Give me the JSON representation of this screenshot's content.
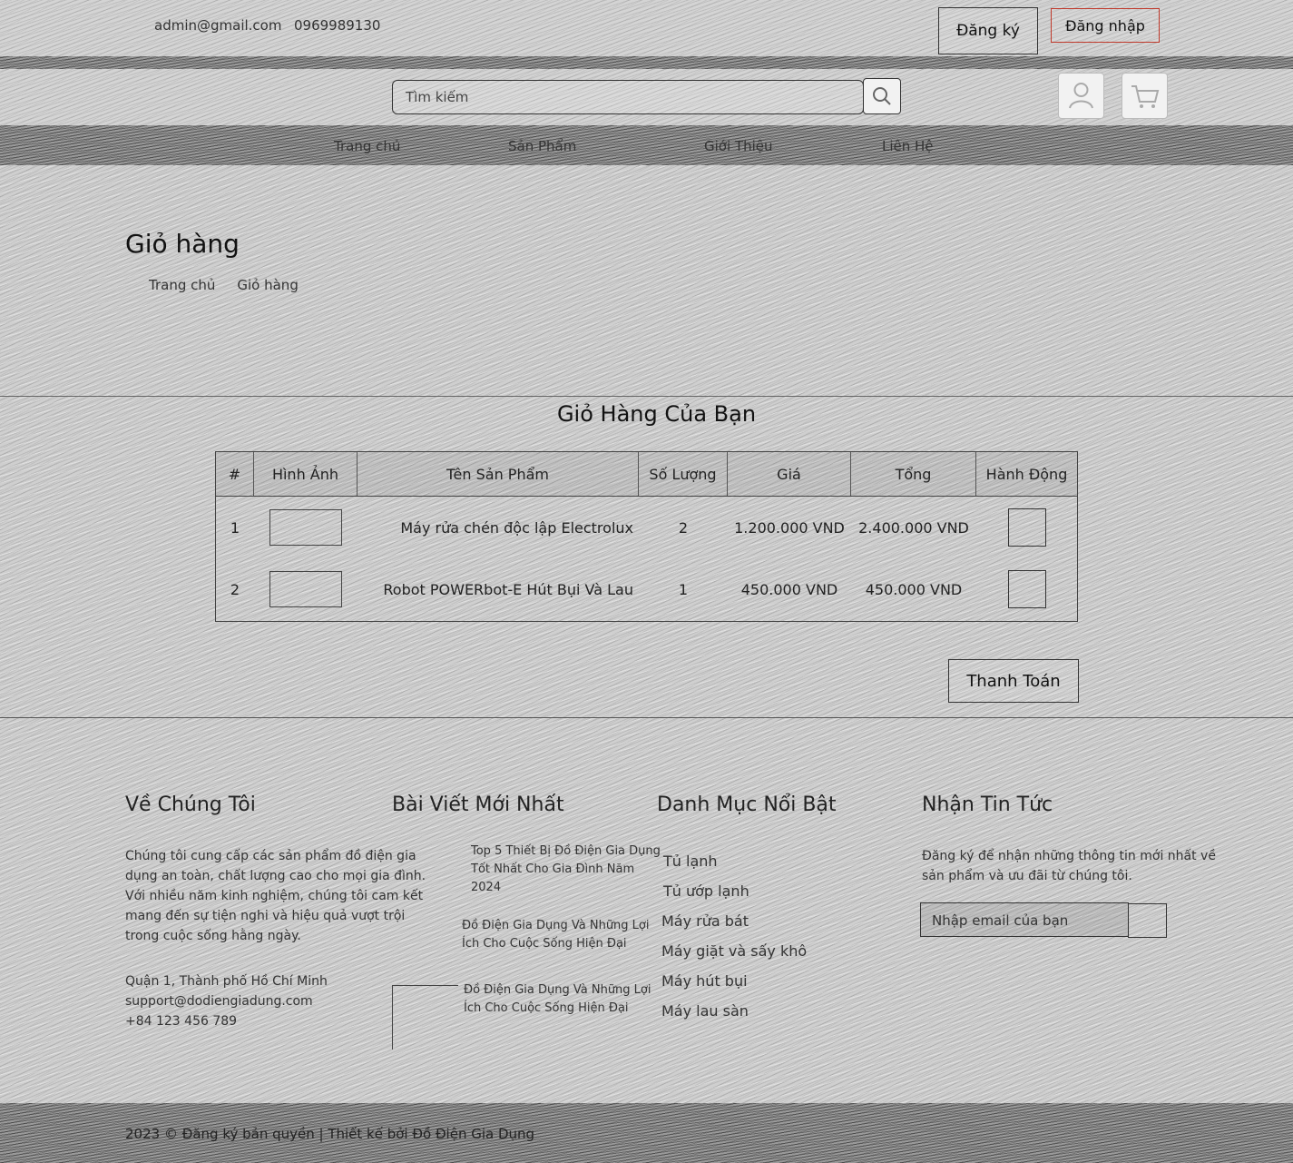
{
  "topbar": {
    "email": "admin@gmail.com",
    "phone": "0969989130",
    "register_label": "Đăng ký",
    "login_label": "Đăng nhập"
  },
  "search": {
    "placeholder": "Tìm kiếm"
  },
  "nav": {
    "items": [
      {
        "label": "Trang chủ"
      },
      {
        "label": "Sản Phẩm"
      },
      {
        "label": "Giới Thiệu"
      },
      {
        "label": "Liên Hệ"
      }
    ]
  },
  "page": {
    "title": "Giỏ hàng",
    "breadcrumb": [
      "Trang chủ",
      "Giỏ hàng"
    ]
  },
  "cart": {
    "heading": "Giỏ Hàng Của Bạn",
    "columns": [
      "#",
      "Hình Ảnh",
      "Tên Sản Phẩm",
      "Số Lượng",
      "Giá",
      "Tổng",
      "Hành Động"
    ],
    "rows": [
      {
        "index": "1",
        "name": "Máy rửa chén độc lập Electrolux",
        "qty": "2",
        "price": "1.200.000 VND",
        "total": "2.400.000 VND"
      },
      {
        "index": "2",
        "name": "Robot POWERbot-E Hút Bụi Và Lau",
        "qty": "1",
        "price": "450.000 VND",
        "total": "450.000 VND"
      }
    ],
    "checkout_label": "Thanh Toán"
  },
  "footer": {
    "about": {
      "title": "Về Chúng Tôi",
      "text": "Chúng tôi cung cấp các sản phẩm đồ điện gia dụng an toàn, chất lượng cao cho mọi gia đình. Với nhiều năm kinh nghiệm, chúng tôi cam kết mang đến sự tiện nghi và hiệu quả vượt trội trong cuộc sống hằng ngày.",
      "address": "Quận 1, Thành phố Hồ Chí Minh",
      "email": "support@dodiengiadung.com",
      "phone": "+84 123 456 789"
    },
    "posts": {
      "title": "Bài Viết Mới Nhất",
      "items": [
        {
          "title": "Top 5 Thiết Bị Đồ Điện Gia Dụng Tốt Nhất Cho Gia Đình Năm 2024"
        },
        {
          "title": "Đồ Điện Gia Dụng Và Những Lợi Ích Cho Cuộc Sống Hiện Đại"
        },
        {
          "title": "Đồ Điện Gia Dụng Và Những Lợi Ích Cho Cuộc Sống Hiện Đại"
        }
      ]
    },
    "categories": {
      "title": "Danh Mục Nổi Bật",
      "items": [
        {
          "label": "Tủ lạnh"
        },
        {
          "label": "Tủ ướp lạnh"
        },
        {
          "label": "Máy rửa bát"
        },
        {
          "label": "Máy giặt và sấy khô"
        },
        {
          "label": "Máy hút bụi"
        },
        {
          "label": "Máy lau sàn"
        }
      ]
    },
    "newsletter": {
      "title": "Nhận Tin Tức",
      "text": "Đăng ký để nhận những thông tin mới nhất về sản phẩm và ưu đãi từ chúng tôi.",
      "placeholder": "Nhập email của bạn"
    },
    "copyright": "2023 © Đăng ký bản quyền | Thiết kế bởi Đồ Điện Gia Dụng"
  },
  "colors": {
    "login_border": "#c0392b"
  }
}
